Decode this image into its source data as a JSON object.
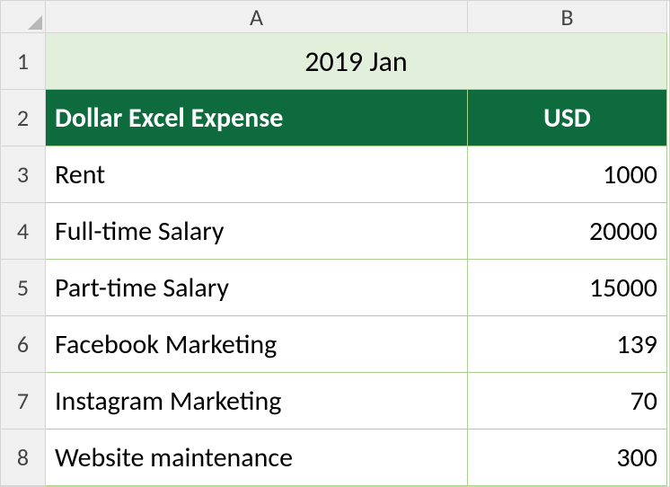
{
  "columns": {
    "A": "A",
    "B": "B"
  },
  "rows": {
    "r1": "1",
    "r2": "2",
    "r3": "3",
    "r4": "4",
    "r5": "5",
    "r6": "6",
    "r7": "7",
    "r8": "8"
  },
  "title": "2019 Jan",
  "headers": {
    "expense": "Dollar Excel Expense",
    "usd": "USD"
  },
  "data": [
    {
      "label": "Rent",
      "value": "1000"
    },
    {
      "label": "Full-time Salary",
      "value": "20000"
    },
    {
      "label": "Part-time Salary",
      "value": "15000"
    },
    {
      "label": "Facebook Marketing",
      "value": "139"
    },
    {
      "label": "Instagram Marketing",
      "value": "70"
    },
    {
      "label": "Website maintenance",
      "value": "300"
    }
  ]
}
